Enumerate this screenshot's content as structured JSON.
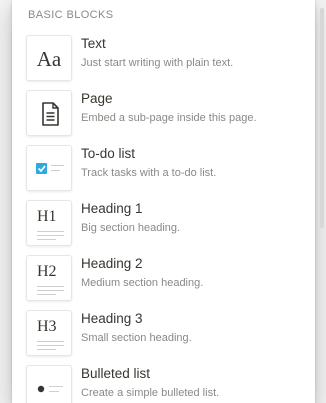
{
  "menu": {
    "section_header": "BASIC BLOCKS",
    "items": [
      {
        "title": "Text",
        "desc": "Just start writing with plain text.",
        "icon": "text-aa-icon",
        "glyph": "Aa"
      },
      {
        "title": "Page",
        "desc": "Embed a sub-page inside this page.",
        "icon": "page-icon"
      },
      {
        "title": "To-do list",
        "desc": "Track tasks with a to-do list.",
        "icon": "checkbox-icon"
      },
      {
        "title": "Heading 1",
        "desc": "Big section heading.",
        "icon": "heading-1-icon",
        "glyph": "H1"
      },
      {
        "title": "Heading 2",
        "desc": "Medium section heading.",
        "icon": "heading-2-icon",
        "glyph": "H2"
      },
      {
        "title": "Heading 3",
        "desc": "Small section heading.",
        "icon": "heading-3-icon",
        "glyph": "H3"
      },
      {
        "title": "Bulleted list",
        "desc": "Create a simple bulleted list.",
        "icon": "bulleted-list-icon"
      }
    ]
  },
  "colors": {
    "checkbox": "#2eaadc",
    "title": "#37352f",
    "muted": "#8a8985"
  }
}
